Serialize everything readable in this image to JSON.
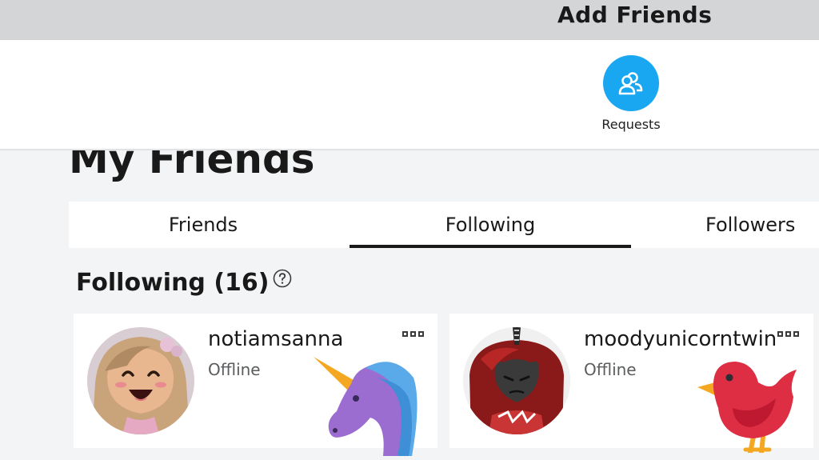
{
  "header": {
    "title": "Add Friends"
  },
  "requests": {
    "label": "Requests",
    "icon": "people-icon",
    "color": "#1aa7f1"
  },
  "page": {
    "title": "My Friends"
  },
  "tabs": [
    {
      "label": "Friends",
      "active": false
    },
    {
      "label": "Following",
      "active": true
    },
    {
      "label": "Followers",
      "active": false
    }
  ],
  "section": {
    "title": "Following (16)",
    "help_icon": "question-circle-icon"
  },
  "cards": [
    {
      "name": "notiamsanna",
      "status": "Offline",
      "sticker": "unicorn-emoji"
    },
    {
      "name": "moodyunicorntwin",
      "status": "Offline",
      "sticker": "red-bird-emoji"
    }
  ]
}
